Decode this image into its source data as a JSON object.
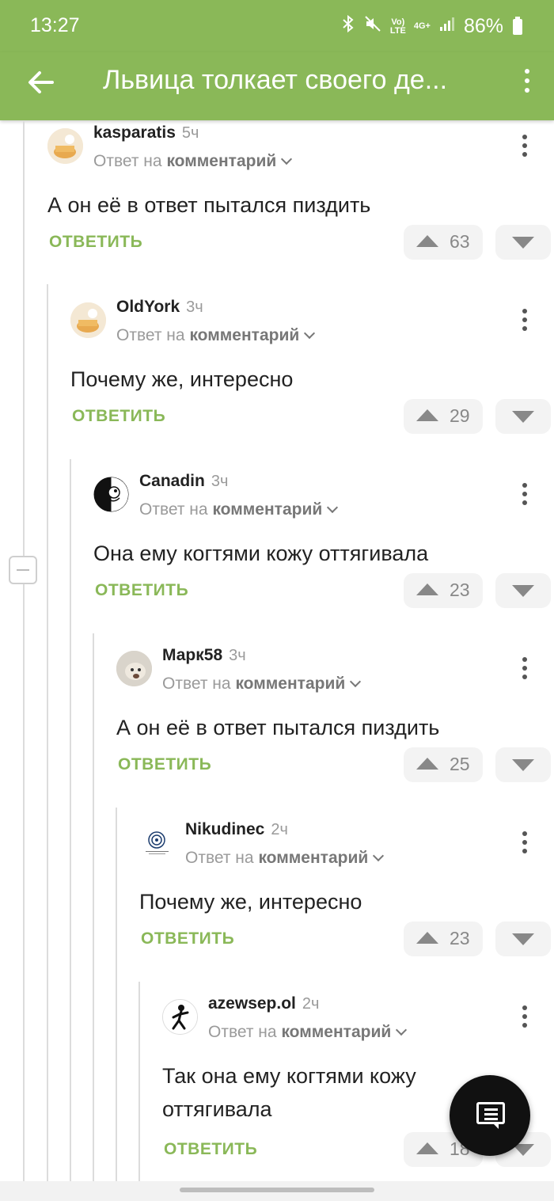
{
  "status_bar": {
    "time": "13:27",
    "volte": "Vo)",
    "lte": "LTE",
    "network": "4G+",
    "battery": "86%"
  },
  "app_bar": {
    "title": "Львица толкает своего де..."
  },
  "comments": [
    {
      "username": "kasparatis",
      "time": "5ч",
      "reply_prefix": "Ответ на",
      "reply_target": "комментарий",
      "text": "А он её в ответ пытался пиздить",
      "reply_label": "ОТВЕТИТЬ",
      "votes": "63",
      "avatar": "pie-avatar"
    },
    {
      "username": "OldYork",
      "time": "3ч",
      "reply_prefix": "Ответ на",
      "reply_target": "комментарий",
      "text": "Почему же, интересно",
      "reply_label": "ОТВЕТИТЬ",
      "votes": "29",
      "avatar": "pie-avatar"
    },
    {
      "username": "Canadin",
      "time": "3ч",
      "reply_prefix": "Ответ на",
      "reply_target": "комментарий",
      "text": "Она ему когтями кожу оттягивала",
      "reply_label": "ОТВЕТИТЬ",
      "votes": "23",
      "avatar": "dog-avatar"
    },
    {
      "username": "Марк58",
      "time": "3ч",
      "reply_prefix": "Ответ на",
      "reply_target": "комментарий",
      "text": "А он её в ответ пытался пиздить",
      "reply_label": "ОТВЕТИТЬ",
      "votes": "25",
      "avatar": "photo-avatar"
    },
    {
      "username": "Nikudinec",
      "time": "2ч",
      "reply_prefix": "Ответ на",
      "reply_target": "комментарий",
      "text": "Почему же, интересно",
      "reply_label": "ОТВЕТИТЬ",
      "votes": "23",
      "avatar": "spiral-avatar"
    },
    {
      "username": "azewsep.ol",
      "time": "2ч",
      "reply_prefix": "Ответ на",
      "reply_target": "комментарий",
      "text": "Так она ему когтями кожу оттягивала",
      "reply_label": "ОТВЕТИТЬ",
      "votes": "18",
      "avatar": "figure-avatar"
    }
  ],
  "colors": {
    "brand": "#8ab858",
    "fab": "#111111"
  }
}
